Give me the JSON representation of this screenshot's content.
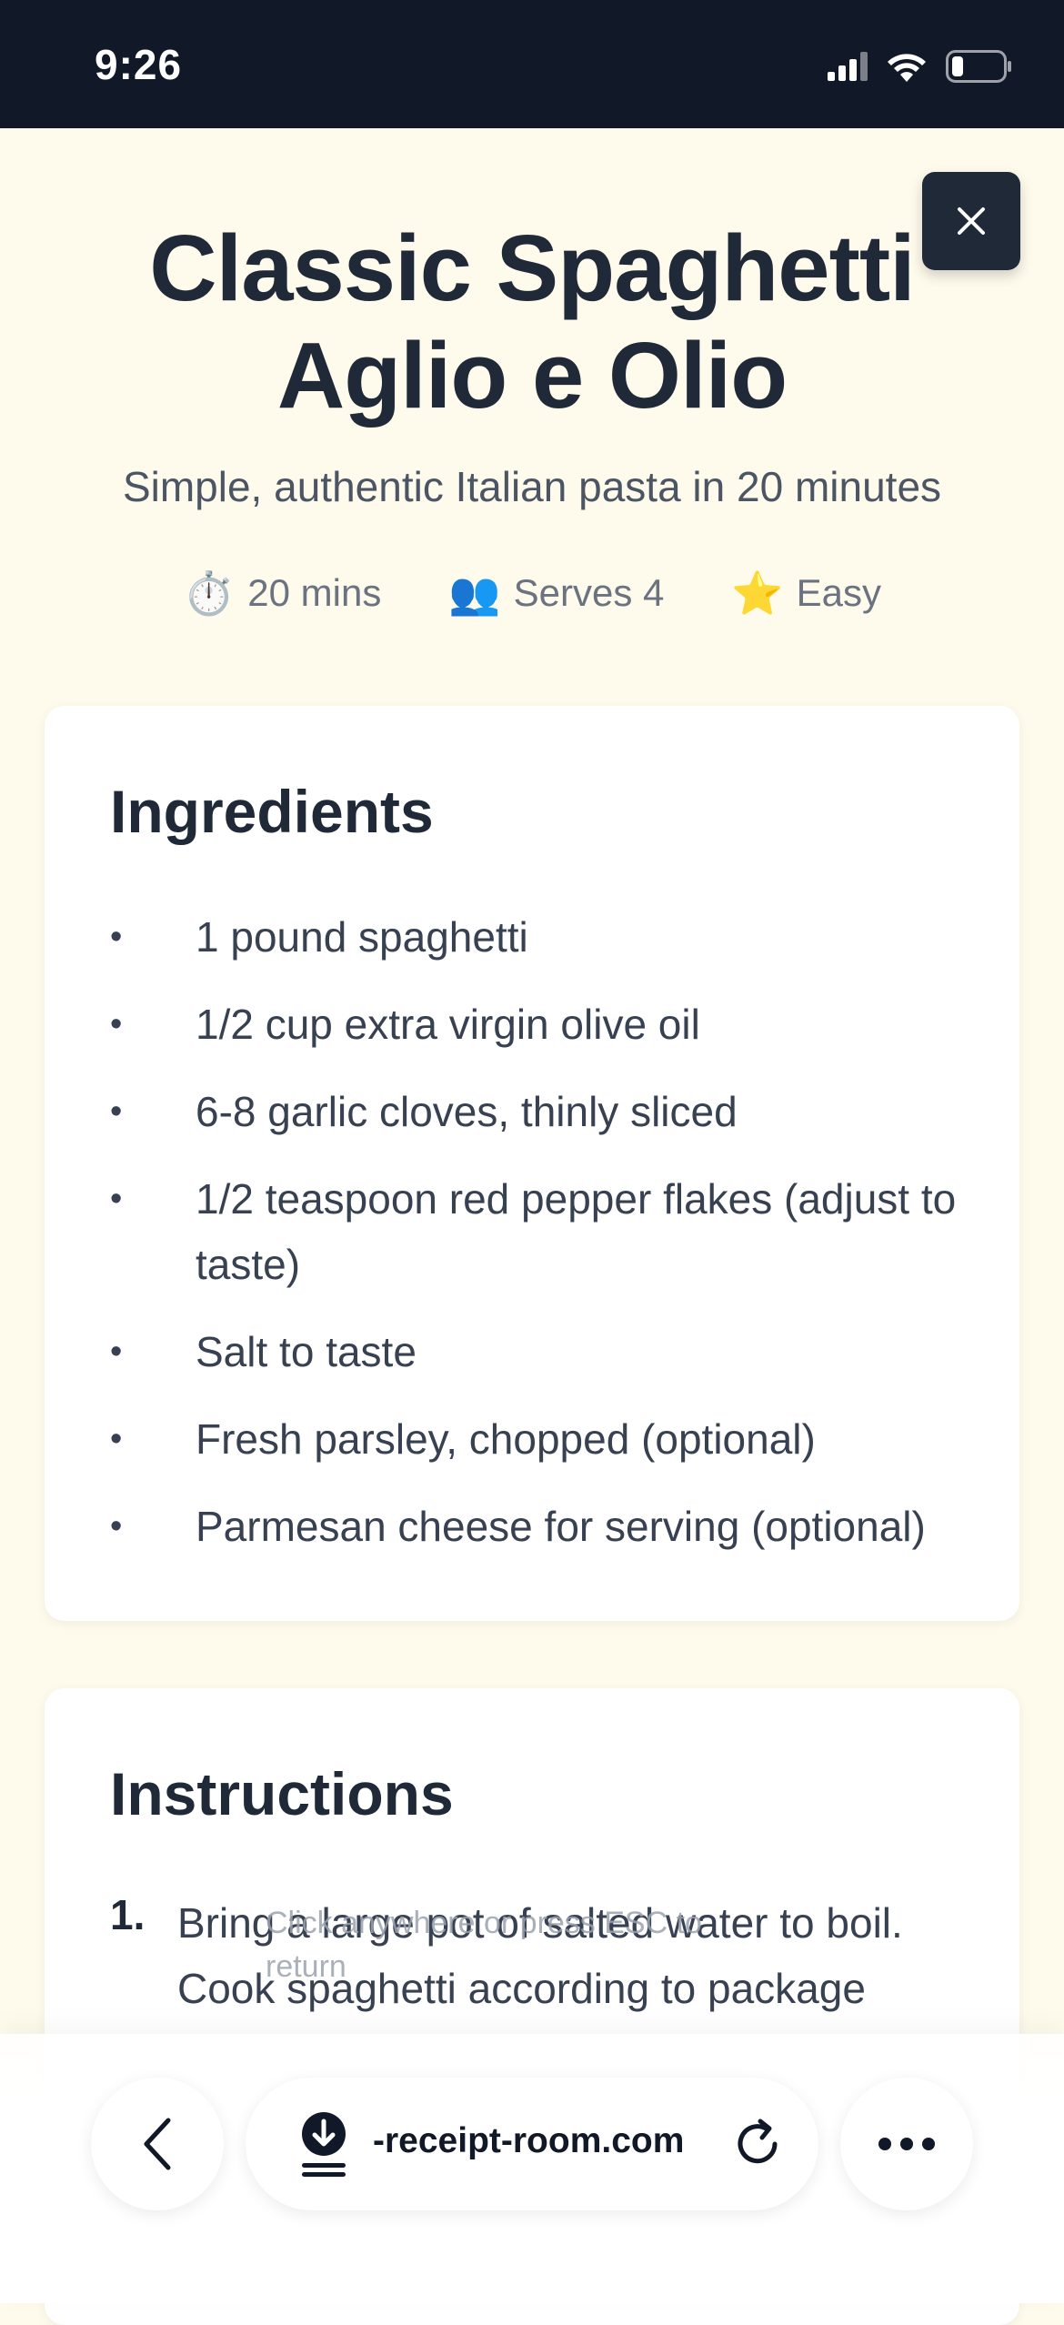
{
  "status_bar": {
    "time": "9:26",
    "icons": [
      "signal-icon",
      "wifi-icon",
      "battery-icon"
    ]
  },
  "recipe": {
    "title": "Classic Spaghetti Aglio e Olio",
    "subtitle": "Simple, authentic Italian pasta in 20 minutes",
    "meta": [
      {
        "icon": "⏱️",
        "icon_name": "stopwatch-icon",
        "label": "20 mins"
      },
      {
        "icon": "👥",
        "icon_name": "people-icon",
        "label": "Serves 4"
      },
      {
        "icon": "⭐",
        "icon_name": "star-icon",
        "label": "Easy"
      }
    ]
  },
  "ingredients": {
    "heading": "Ingredients",
    "bullet": "•",
    "items": [
      "1 pound spaghetti",
      "1/2 cup extra virgin olive oil",
      "6-8 garlic cloves, thinly sliced",
      "1/2 teaspoon red pepper flakes (adjust to taste)",
      "Salt to taste",
      "Fresh parsley, chopped (optional)",
      "Parmesan cheese for serving (optional)"
    ]
  },
  "instructions": {
    "heading": "Instructions",
    "steps": [
      {
        "number": "1.",
        "text": "Bring a large pot of salted water to boil. Cook spaghetti according to package"
      }
    ]
  },
  "overlay_hint": "Click anywhere or press ESC to return",
  "browser": {
    "url": "-receipt-room.com",
    "icons": [
      "back-chevron-icon",
      "download-icon",
      "reload-icon",
      "more-dots-icon"
    ]
  },
  "colors": {
    "background": "#fefaec",
    "status_bar": "#111827",
    "text_dark": "#1f2937",
    "text_muted": "#6b7280",
    "card": "#ffffff"
  }
}
